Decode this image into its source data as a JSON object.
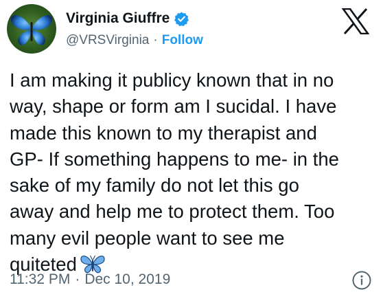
{
  "author": {
    "display_name": "Virginia Giuffre",
    "handle": "@VRSVirginia",
    "separator": "·",
    "follow_label": "Follow",
    "verified": true,
    "avatar_icon": "blue-butterfly-icon"
  },
  "tweet": {
    "lines": [
      "I am making it publicy known that in no",
      "way, shape or form am I sucidal. I have",
      "made this known to my therapist and",
      "GP- If something happens to me- in the",
      "sake of my family do not let this go",
      "away and help me to protect them. Too",
      "many evil people want to see me",
      "quiteted"
    ],
    "trailing_emoji": "butterfly-emoji"
  },
  "meta": {
    "time": "11:32 PM",
    "separator": "·",
    "date": "Dec 10, 2019"
  },
  "icons": {
    "brand": "x-logo-icon",
    "verified": "verified-badge-icon",
    "info": "info-icon"
  },
  "colors": {
    "text": "#0f1419",
    "secondary_text": "#536471",
    "accent": "#1d9bf0",
    "butterfly_blue": "#3a78c8"
  }
}
